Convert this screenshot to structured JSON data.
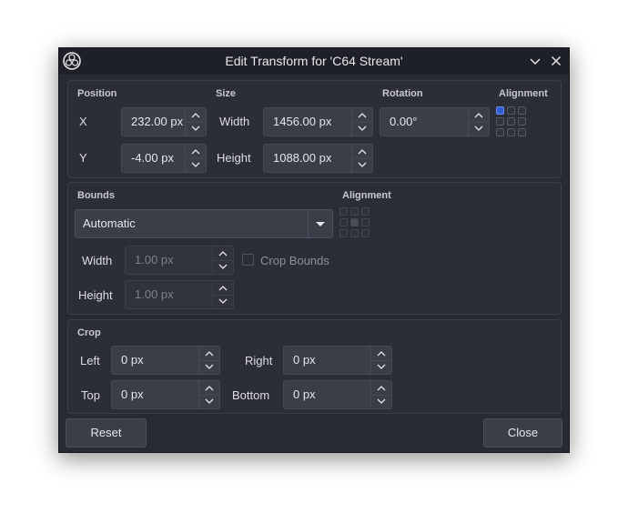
{
  "window": {
    "title": "Edit Transform for 'C64 Stream'"
  },
  "position": {
    "title": "Position",
    "x_label": "X",
    "x_value": "232.00 px",
    "y_label": "Y",
    "y_value": "-4.00 px"
  },
  "size": {
    "title": "Size",
    "width_label": "Width",
    "width_value": "1456.00 px",
    "height_label": "Height",
    "height_value": "1088.00 px"
  },
  "rotation": {
    "title": "Rotation",
    "value": "0.00°"
  },
  "alignment": {
    "title": "Alignment",
    "selected": "top-left"
  },
  "bounds": {
    "title": "Bounds",
    "type_value": "Automatic",
    "alignment_title": "Alignment",
    "alignment_selected": "center",
    "width_label": "Width",
    "width_value": "1.00 px",
    "height_label": "Height",
    "height_value": "1.00 px",
    "crop_bounds_label": "Crop Bounds",
    "crop_bounds_checked": false
  },
  "crop": {
    "title": "Crop",
    "left_label": "Left",
    "left_value": "0 px",
    "right_label": "Right",
    "right_value": "0 px",
    "top_label": "Top",
    "top_value": "0 px",
    "bottom_label": "Bottom",
    "bottom_value": "0 px"
  },
  "buttons": {
    "reset_label": "Reset",
    "close_label": "Close"
  },
  "colors": {
    "window_bg": "#272a33",
    "titlebar_bg": "#1e2027",
    "selected_accent": "#2f5fd0"
  }
}
